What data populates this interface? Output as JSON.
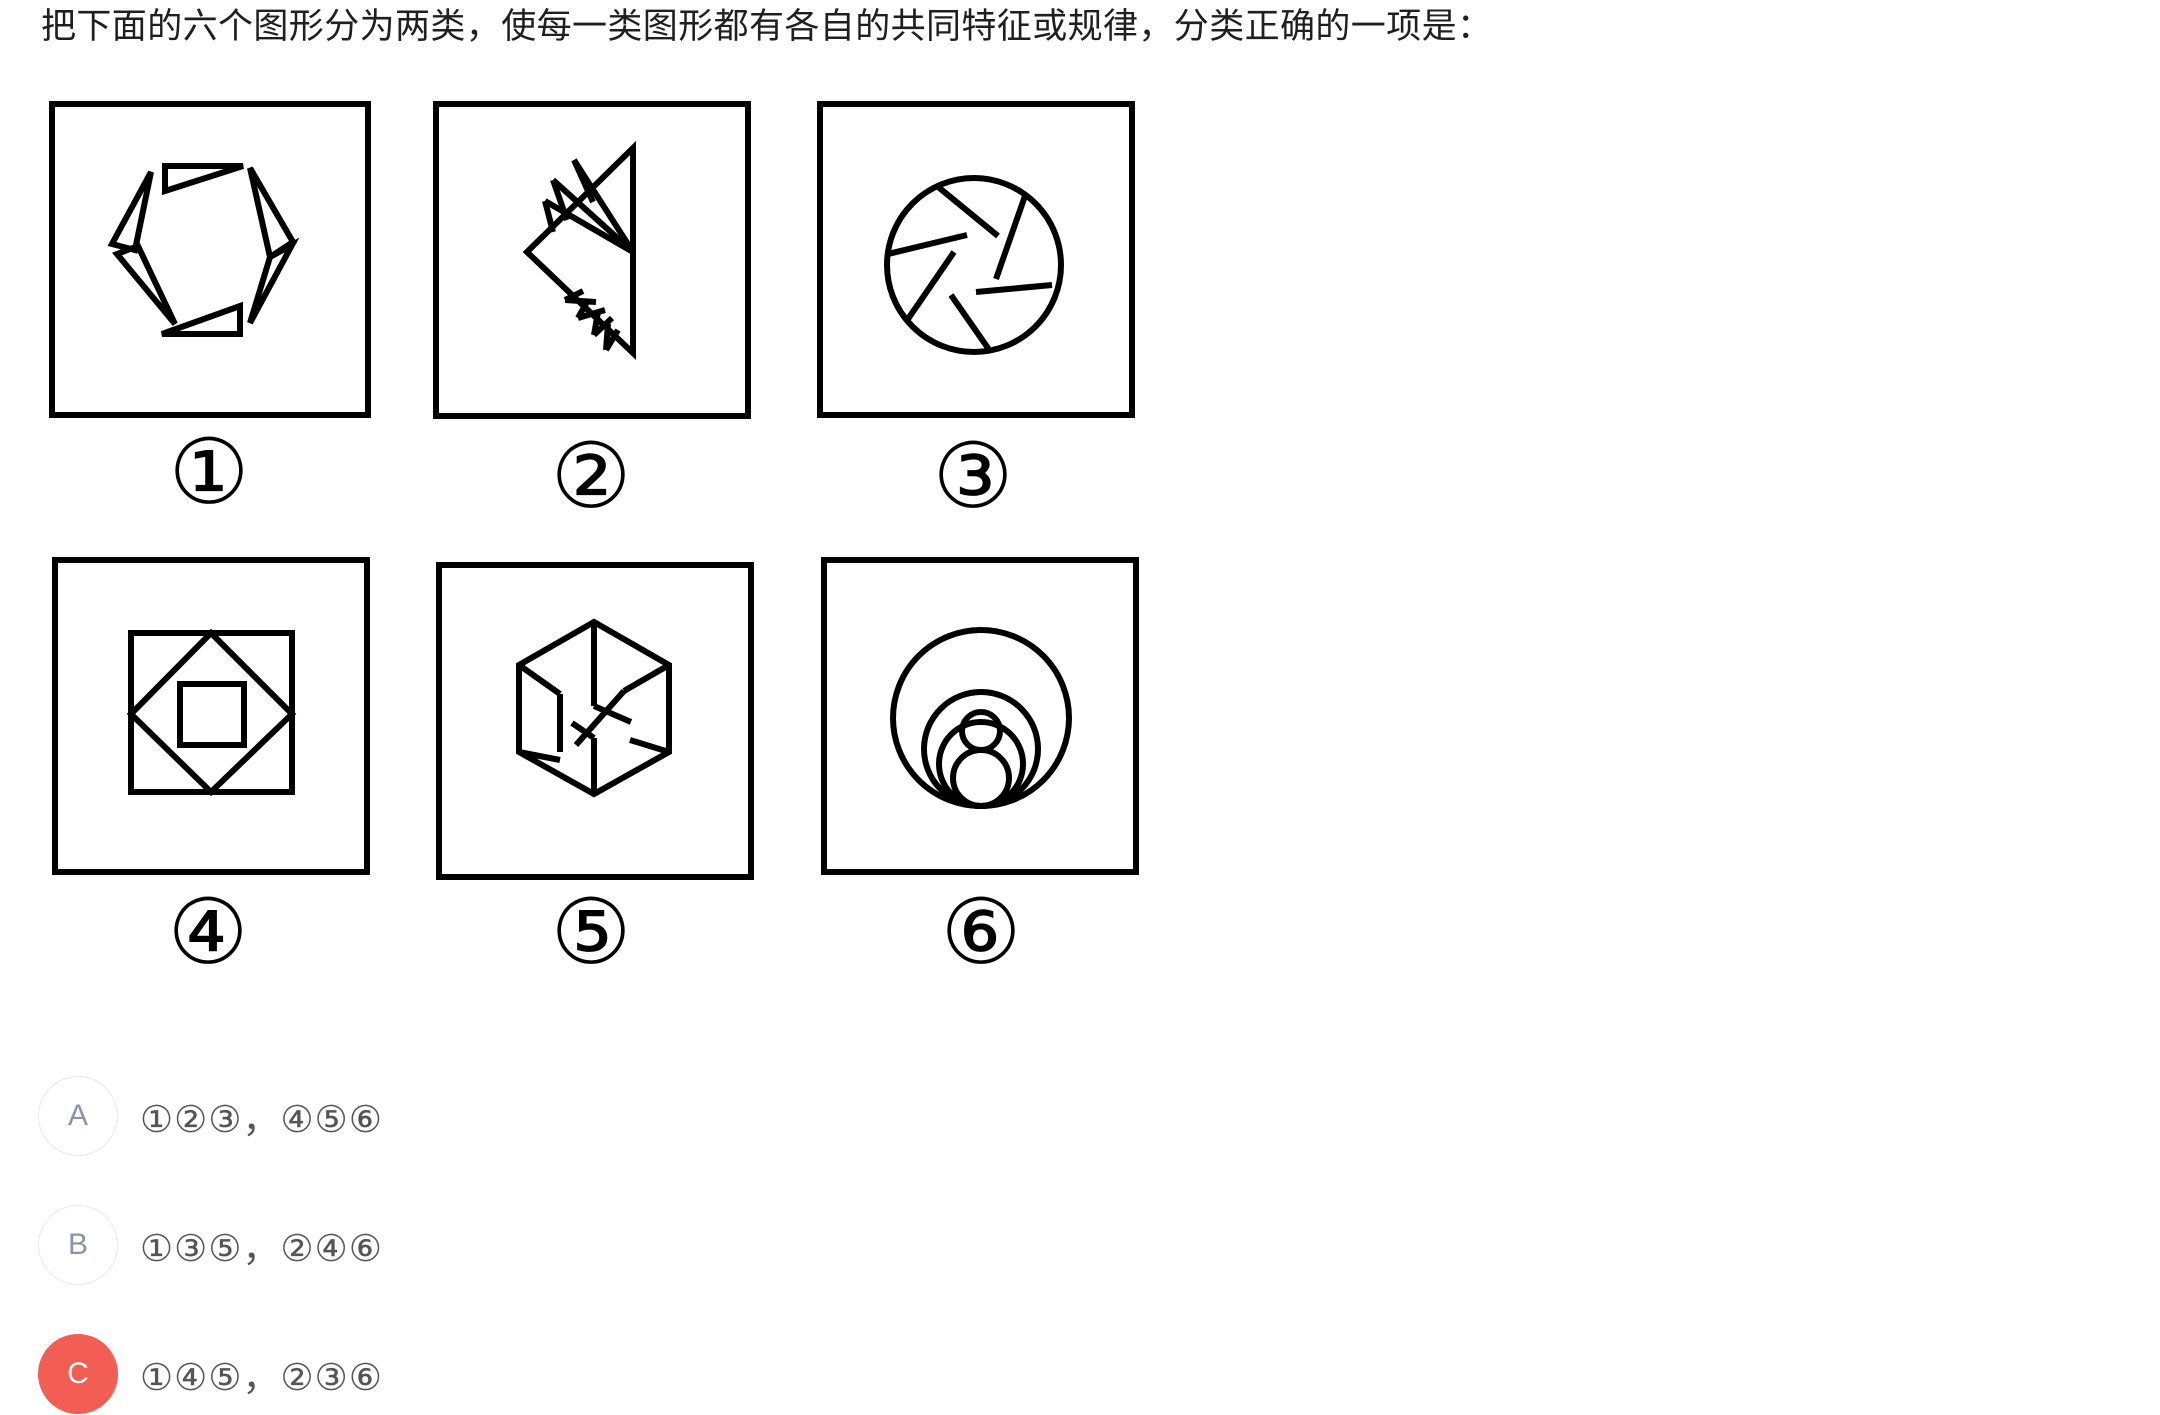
{
  "question": {
    "text": "把下面的六个图形分为两类，使每一类图形都有各自的共同特征或规律，分类正确的一项是："
  },
  "figures": [
    {
      "label": "①"
    },
    {
      "label": "②"
    },
    {
      "label": "③"
    },
    {
      "label": "④"
    },
    {
      "label": "⑤"
    },
    {
      "label": "⑥"
    }
  ],
  "options": [
    {
      "letter": "A",
      "text": "①②③，④⑤⑥",
      "selected": false
    },
    {
      "letter": "B",
      "text": "①③⑤，②④⑥",
      "selected": false
    },
    {
      "letter": "C",
      "text": "①④⑤，②③⑥",
      "selected": true
    }
  ],
  "colors": {
    "selected": "#f25d54",
    "option_border": "#e6e8ee",
    "option_letter": "#8c93a8"
  }
}
